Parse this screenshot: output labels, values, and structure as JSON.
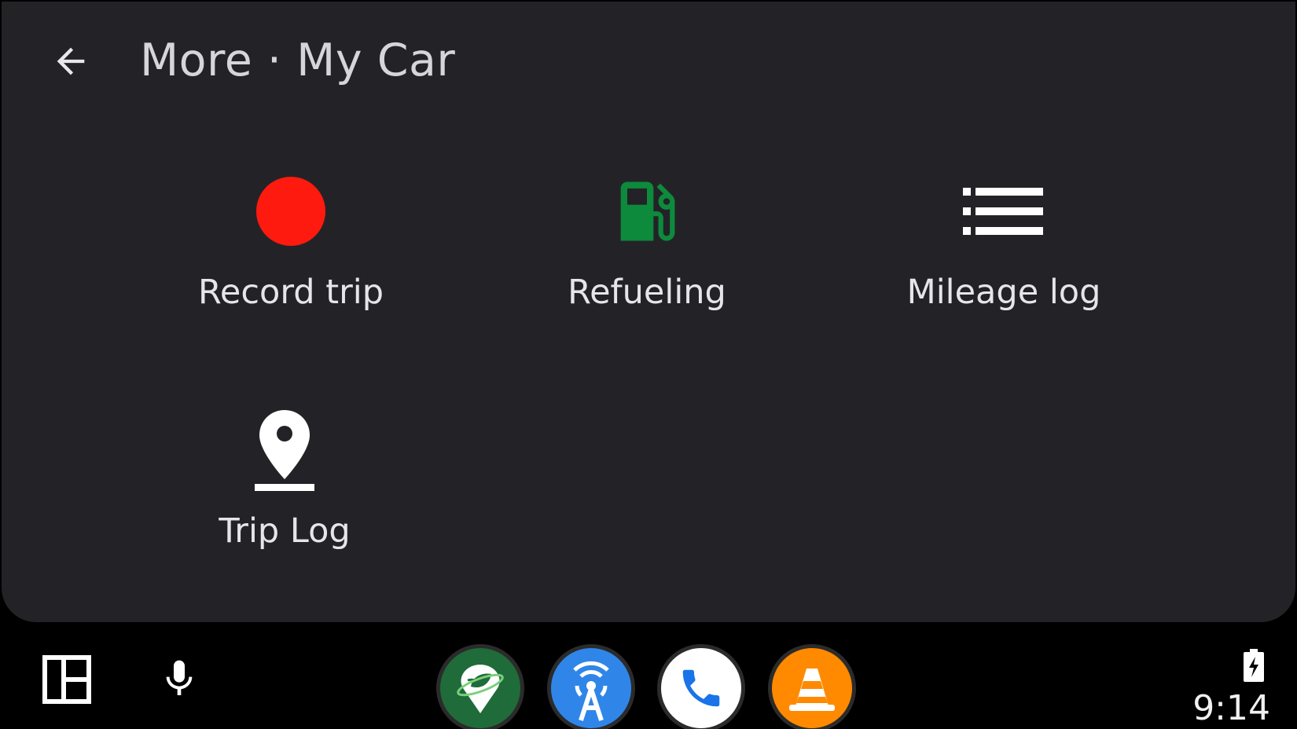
{
  "header": {
    "back_icon": "arrow-back-icon",
    "title": "More · My Car"
  },
  "tiles": [
    {
      "label": "Record trip",
      "icon": "record-dot-icon",
      "color": "#ff1a0f"
    },
    {
      "label": "Refueling",
      "icon": "fuel-pump-icon",
      "color": "#0d8a3c"
    },
    {
      "label": "Mileage log",
      "icon": "list-icon",
      "color": "#ffffff"
    },
    {
      "label": "Trip Log",
      "icon": "location-pin-icon",
      "color": "#ffffff"
    }
  ],
  "bottom_bar": {
    "dashboard_icon": "split-screen-icon",
    "mic_icon": "microphone-icon",
    "dock_apps": [
      {
        "icon": "eco-leaf-pin-app-icon",
        "color": "#1f6b3a"
      },
      {
        "icon": "antenna-radio-app-icon",
        "color": "#2f86e8"
      },
      {
        "icon": "phone-app-icon",
        "color": "#ffffff"
      },
      {
        "icon": "traffic-cone-app-icon",
        "color": "#ff8a00"
      }
    ],
    "battery_icon": "battery-charging-icon",
    "clock": "9:14"
  },
  "colors": {
    "background": "#232327",
    "bar": "#000000",
    "text": "#e6e6ea"
  }
}
